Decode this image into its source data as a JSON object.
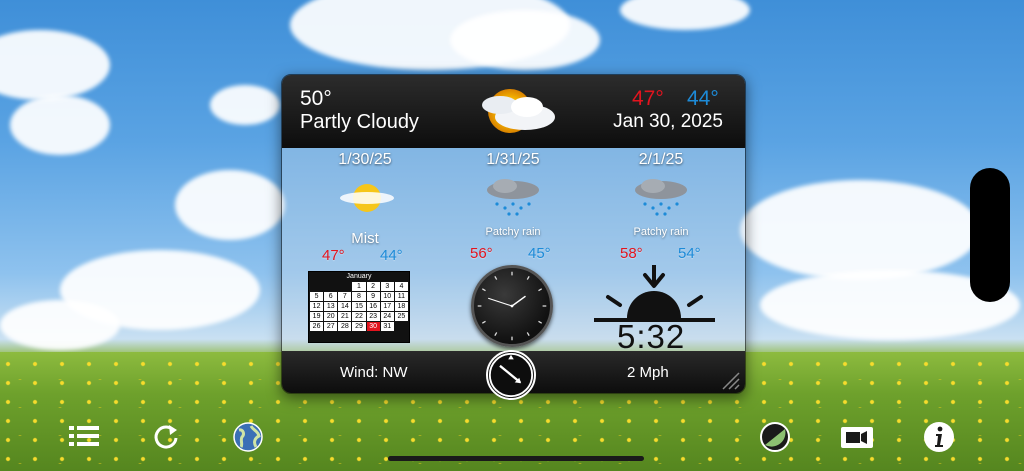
{
  "header": {
    "current_temp": "50°",
    "condition": "Partly Cloudy",
    "high": "47°",
    "low": "44°",
    "date": "Jan 30, 2025",
    "icon": "partly-cloudy-icon"
  },
  "days": [
    {
      "date": "1/30/25",
      "condition": "Mist",
      "high": "47°",
      "low": "44°",
      "icon": "sun-haze-icon"
    },
    {
      "date": "1/31/25",
      "condition": "Patchy rain",
      "high": "56°",
      "low": "45°",
      "icon": "rain-cloud-icon"
    },
    {
      "date": "2/1/25",
      "condition": "Patchy rain",
      "high": "58°",
      "low": "54°",
      "icon": "rain-cloud-icon"
    }
  ],
  "calendar": {
    "month": "January",
    "today": "30",
    "cells": [
      "",
      "",
      "",
      "1",
      "2",
      "3",
      "4",
      "5",
      "6",
      "7",
      "8",
      "9",
      "10",
      "11",
      "12",
      "13",
      "14",
      "15",
      "16",
      "17",
      "18",
      "19",
      "20",
      "21",
      "22",
      "23",
      "24",
      "25",
      "26",
      "27",
      "28",
      "29",
      "30",
      "31",
      ""
    ]
  },
  "clock": {
    "hour": 1,
    "minute": 48
  },
  "sunset": {
    "time": "5:32",
    "icon": "sunset-icon"
  },
  "footer": {
    "wind_label": "Wind:  NW",
    "wind_speed": "2 Mph",
    "compass_icon": "wind-direction-compass-icon"
  },
  "toolbar": {
    "left": [
      "menu-list-icon",
      "refresh-icon",
      "globe-icon"
    ],
    "right": [
      "theme-icon",
      "video-icon",
      "info-icon"
    ]
  },
  "colors": {
    "high": "#e3141e",
    "low": "#1d8bd8",
    "today": "#e3141e"
  }
}
